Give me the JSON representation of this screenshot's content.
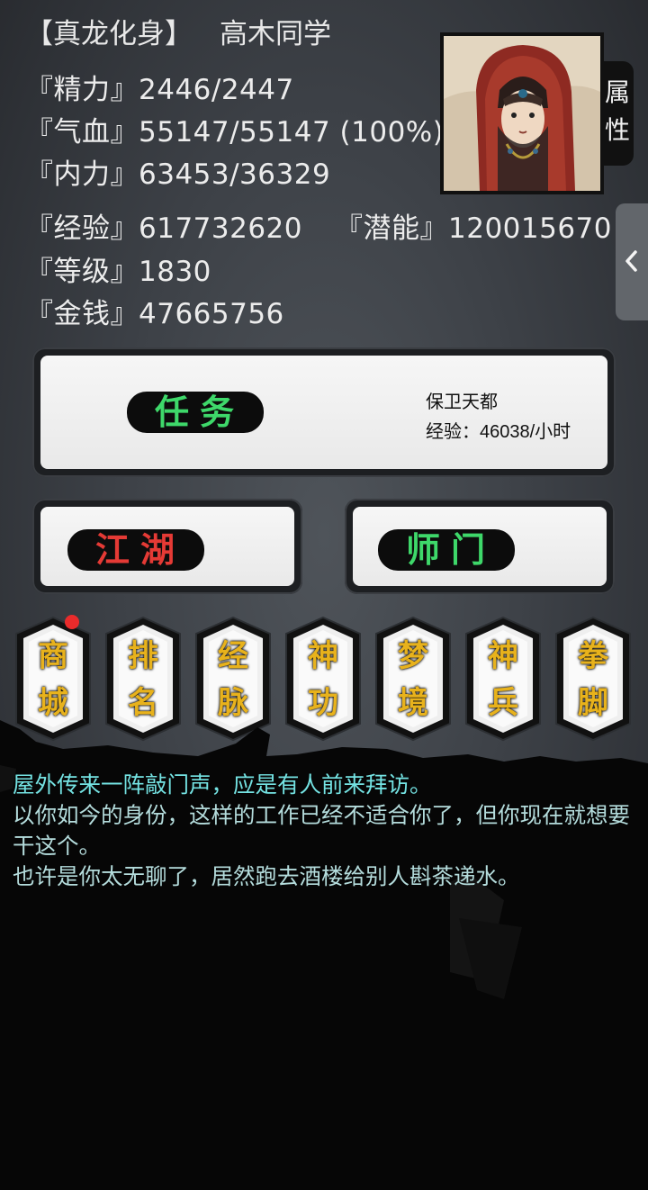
{
  "header": {
    "title_tag": "【真龙化身】",
    "player_name": "高木同学"
  },
  "stats": {
    "jingli": "『精力』2446/2447",
    "qixue": "『气血』55147/55147 (100%)",
    "neili": "『内力』63453/36329",
    "jingyan": "『经验』617732620",
    "qianneng": "『潜能』120015670",
    "dengji": "『等级』1830",
    "jinqian": "『金钱』47665756"
  },
  "attr_tab": {
    "line1": "属",
    "line2": "性"
  },
  "quest_panel": {
    "button_label": "任务",
    "quest_name": "保卫天都",
    "quest_reward": "经验：46038/小时",
    "button_color": "#3ed86a"
  },
  "jianghu_button": {
    "label": "江湖",
    "color": "#e53a35"
  },
  "shimen_button": {
    "label": "师门",
    "color": "#3ed86a"
  },
  "function_buttons": [
    {
      "line1": "商",
      "line2": "城",
      "has_notification": true
    },
    {
      "line1": "排",
      "line2": "名",
      "has_notification": false
    },
    {
      "line1": "经",
      "line2": "脉",
      "has_notification": false
    },
    {
      "line1": "神",
      "line2": "功",
      "has_notification": false
    },
    {
      "line1": "梦",
      "line2": "境",
      "has_notification": false
    },
    {
      "line1": "神",
      "line2": "兵",
      "has_notification": false
    },
    {
      "line1": "拳",
      "line2": "脚",
      "has_notification": false
    }
  ],
  "function_label_color": "#e8b21c",
  "message_log": {
    "line1": "屋外传来一阵敲门声，应是有人前来拜访。",
    "line2": "以你如今的身份，这样的工作已经不适合你了，但你现在就想要干这个。",
    "line3": "也许是你太无聊了，居然跑去酒楼给别人斟茶递水。"
  },
  "icons": {
    "side_handle": "chevron-left-icon",
    "notification": "red-dot-icon"
  }
}
